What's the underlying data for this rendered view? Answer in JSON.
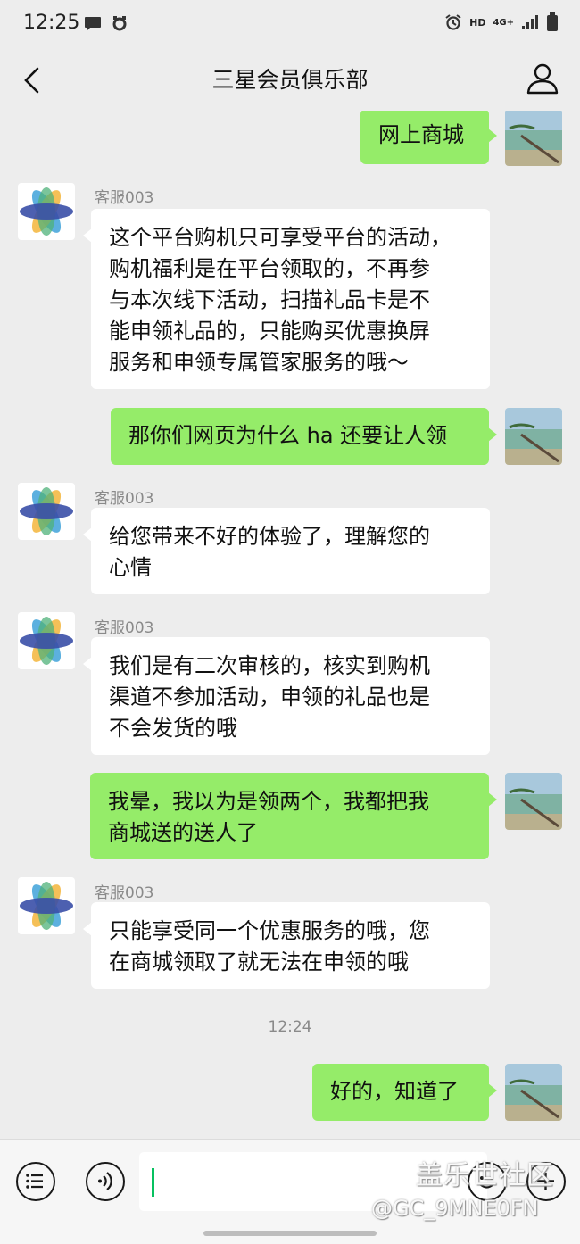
{
  "status_bar": {
    "time": "12:25",
    "network": "HD",
    "signal_type": "4G+"
  },
  "header": {
    "title": "三星会员俱乐部"
  },
  "messages": [
    {
      "direction": "out",
      "text": "网上商城"
    },
    {
      "direction": "in",
      "sender": "客服003",
      "lines": [
        "这个平台购机只可享受平台的活动，",
        "购机福利是在平台领取的，不再参",
        "与本次线下活动，扫描礼品卡是不",
        "能申领礼品的，只能购买优惠换屏",
        "服务和申领专属管家服务的哦～"
      ]
    },
    {
      "direction": "out",
      "text": "那你们网页为什么 ha 还要让人领"
    },
    {
      "direction": "in",
      "sender": "客服003",
      "lines": [
        "给您带来不好的体验了，理解您的",
        "心情"
      ]
    },
    {
      "direction": "in",
      "sender": "客服003",
      "lines": [
        "我们是有二次审核的，核实到购机",
        "渠道不参加活动，申领的礼品也是",
        "不会发货的哦"
      ]
    },
    {
      "direction": "out",
      "lines": [
        "我晕，我以为是领两个，我都把我",
        "商城送的送人了"
      ]
    },
    {
      "direction": "in",
      "sender": "客服003",
      "lines": [
        "只能享受同一个优惠服务的哦，您",
        "在商城领取了就无法在申领的哦"
      ]
    },
    {
      "direction": "out",
      "text": "好的，知道了"
    }
  ],
  "time_divider": "12:24",
  "watermark": {
    "line1": "盖乐世社区",
    "line2": "@GC_9MNE0FN"
  },
  "icons": {
    "back": "chevron-left-icon",
    "profile": "person-icon",
    "more": "list-icon",
    "voice": "voice-icon",
    "emoji": "emoji-icon",
    "plus": "plus-icon"
  }
}
